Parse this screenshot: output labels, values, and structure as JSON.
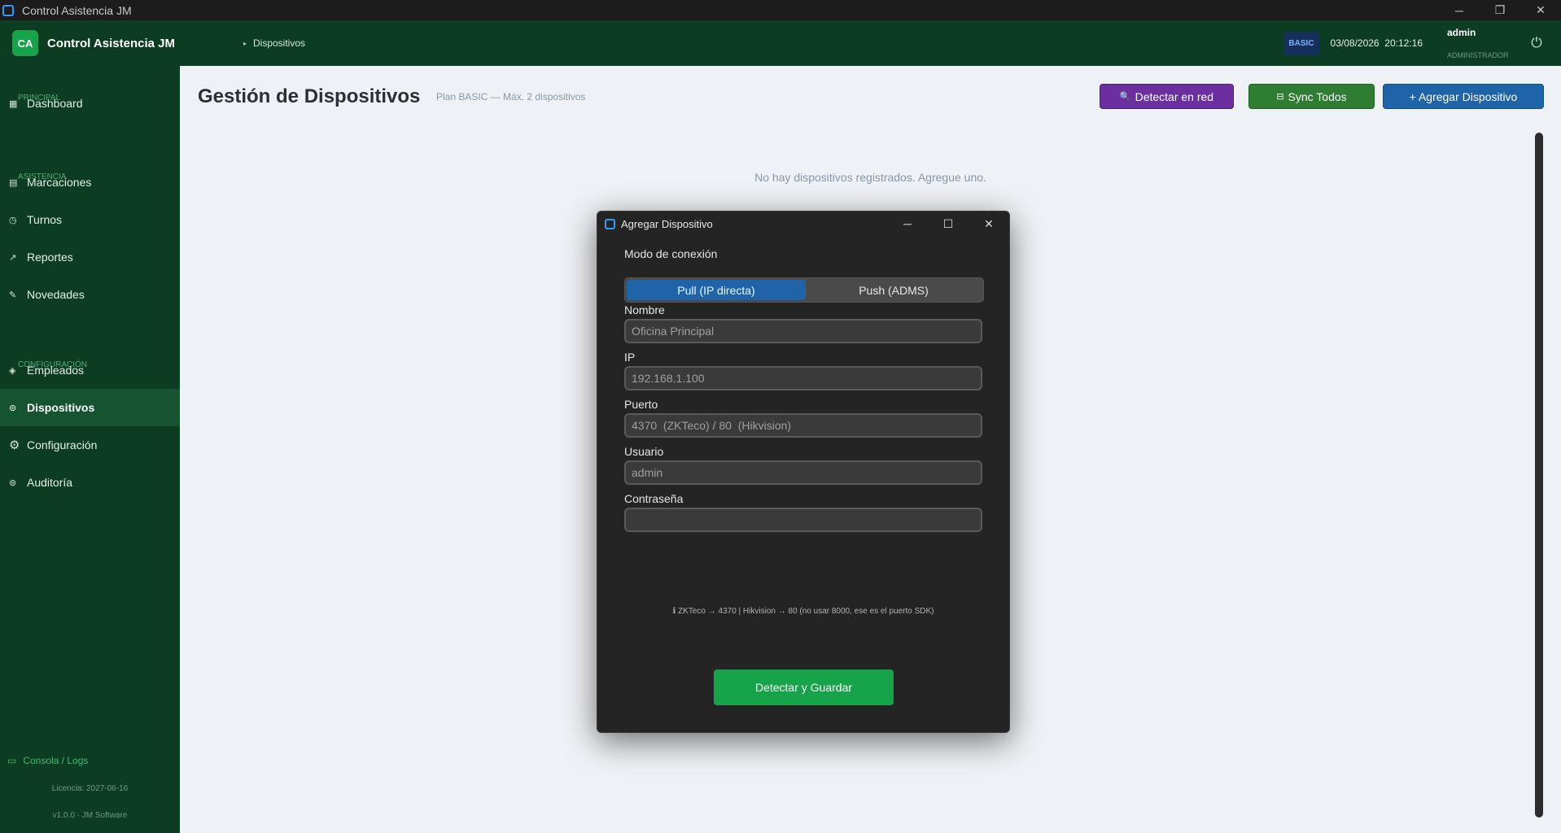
{
  "os_window": {
    "title": "Control Asistencia JM",
    "minimize_icon": "─",
    "restore_icon": "❐",
    "close_icon": "✕"
  },
  "header": {
    "logo_initials": "CA",
    "app_name": "Control Asistencia JM",
    "breadcrumb": "Dispositivos",
    "plan_badge": "BASIC",
    "date": "03/08/2026",
    "time": "20:12:16",
    "user_name": "admin",
    "user_role": "ADMINISTRADOR",
    "power_icon": "⏻"
  },
  "sidebar": {
    "sections": {
      "principal": "PRINCIPAL",
      "asistencia": "ASISTENCIA",
      "configuracion": "CONFIGURACIÓN"
    },
    "items": [
      {
        "label": "Dashboard",
        "icon": "▦"
      },
      {
        "label": "Marcaciones",
        "icon": "▤"
      },
      {
        "label": "Turnos",
        "icon": "◷"
      },
      {
        "label": "Reportes",
        "icon": "↗"
      },
      {
        "label": "Novedades",
        "icon": "✎"
      },
      {
        "label": "Empleados",
        "icon": "◈"
      },
      {
        "label": "Dispositivos",
        "icon": "⊙"
      },
      {
        "label": "Configuración",
        "icon": "⚙"
      },
      {
        "label": "Auditoría",
        "icon": "⊚"
      }
    ],
    "active_item": "Dispositivos",
    "console_label": "Consola / Logs",
    "console_icon": "▭",
    "license": "Licencia: 2027-06-16",
    "version": "v1.0.0 · JM Software"
  },
  "main": {
    "title": "Gestión de Dispositivos",
    "subtitle": "Plan BASIC — Máx. 2 dispositivos",
    "detect_button": "Detectar en red",
    "detect_icon": "🔍",
    "sync_button": "Sync Todos",
    "sync_icon": "⊟",
    "add_button": "+ Agregar Dispositivo",
    "empty_message": "No hay dispositivos registrados. Agregue uno."
  },
  "dialog": {
    "title": "Agregar Dispositivo",
    "mode_label": "Modo de conexión",
    "mode_options": [
      "Pull (IP directa)",
      "Push (ADMS)"
    ],
    "mode_selected": "Pull (IP directa)",
    "name_label": "Nombre",
    "name_placeholder": "Oficina Principal",
    "ip_label": "IP",
    "ip_placeholder": "192.168.1.100",
    "port_label": "Puerto",
    "port_placeholder": "4370  (ZKTeco) / 80  (Hikvision)",
    "user_label": "Usuario",
    "user_placeholder": "admin",
    "password_label": "Contraseña",
    "password_value": "",
    "hint": "ℹ ZKTeco → 4370  |  Hikvision → 80  (no usar 8000, ese es el puerto SDK)",
    "save_button": "Detectar y Guardar",
    "minimize_icon": "─",
    "maximize_icon": "☐",
    "close_icon": "✕"
  },
  "colors": {
    "sidebar_bg": "#0c3d22",
    "sidebar_active": "#165431",
    "accent_green": "#16a34a",
    "detect_purple": "#6b2fa0",
    "sync_green": "#2e7d32",
    "add_blue": "#1f64a8",
    "dialog_bg": "#242424"
  }
}
